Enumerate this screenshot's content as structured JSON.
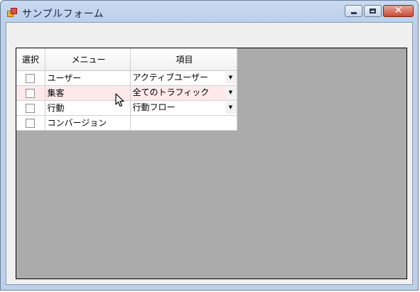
{
  "window": {
    "title": "サンプルフォーム",
    "controls": {
      "minimize": "minimize-icon",
      "maximize": "maximize-icon",
      "close": "✕"
    }
  },
  "grid": {
    "columns": [
      "選択",
      "メニュー",
      "項目"
    ],
    "rows": [
      {
        "checked": false,
        "menu": "ユーザー",
        "item": "アクティブユーザー",
        "has_dropdown": true,
        "hover": false
      },
      {
        "checked": false,
        "menu": "集客",
        "item": "全てのトラフィック",
        "has_dropdown": true,
        "hover": true
      },
      {
        "checked": false,
        "menu": "行動",
        "item": "行動フロー",
        "has_dropdown": true,
        "hover": false
      },
      {
        "checked": false,
        "menu": "コンバージョン",
        "item": "",
        "has_dropdown": false,
        "hover": false
      }
    ],
    "dropdown_arrow": "▼",
    "hover_row_color": "#fde9e9",
    "background_color": "#ababab"
  }
}
